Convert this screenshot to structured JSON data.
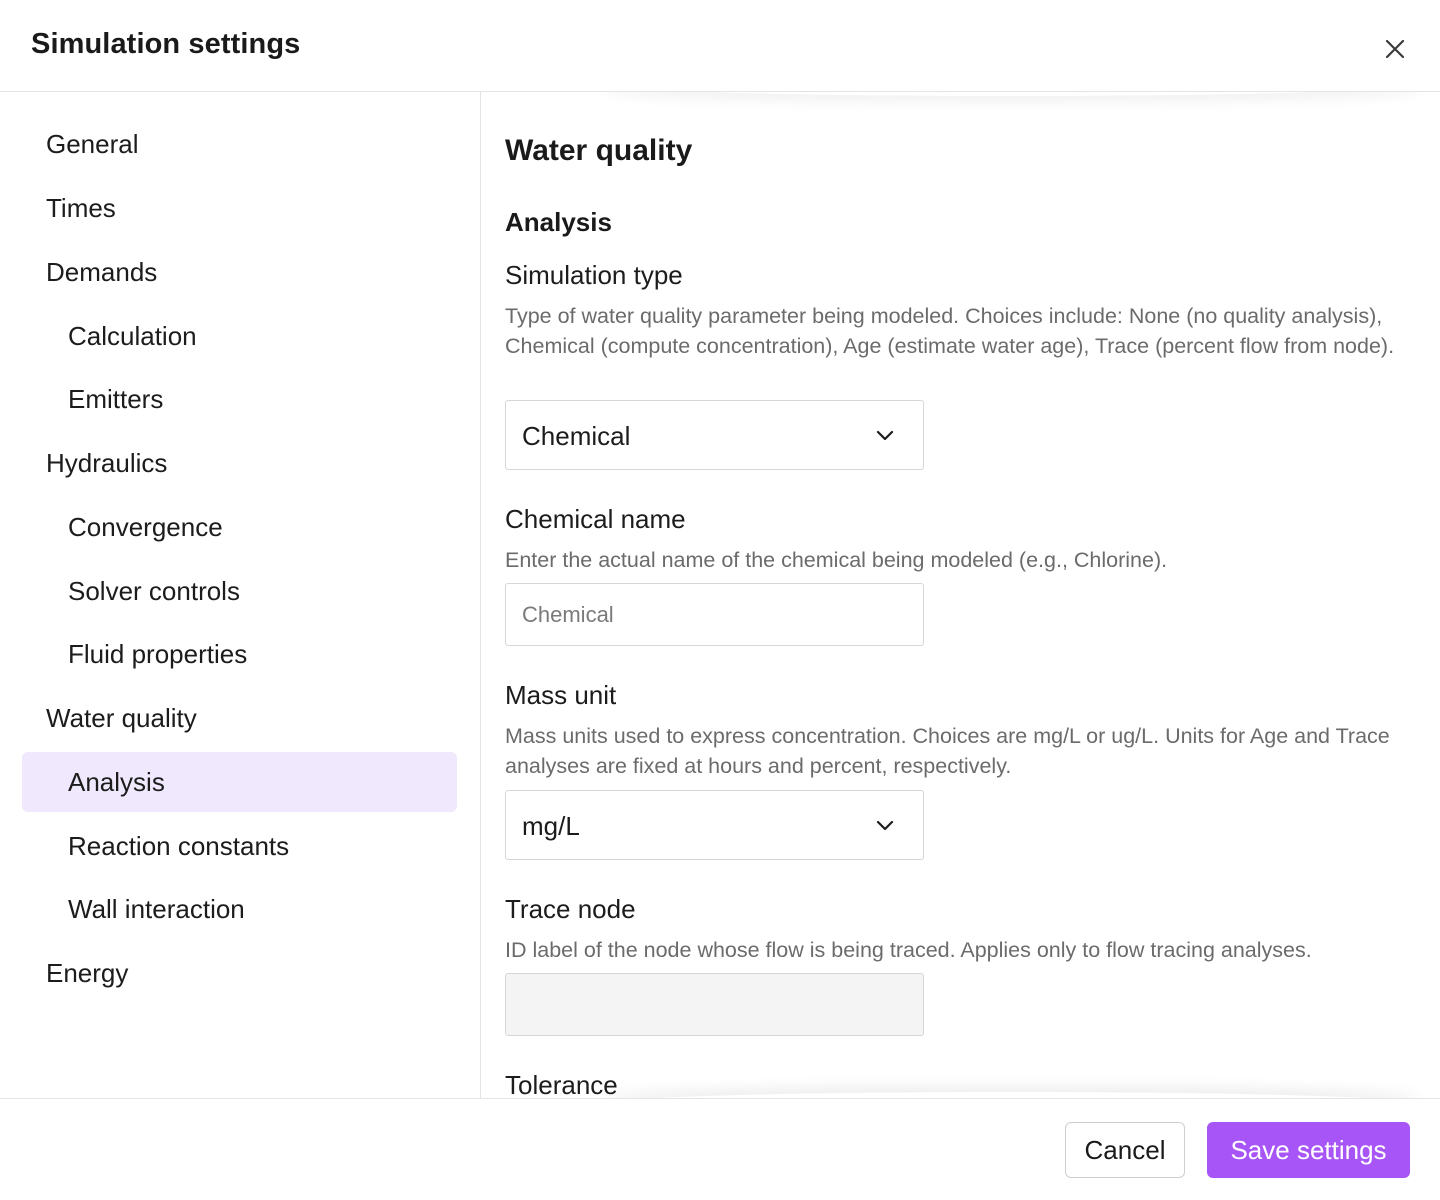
{
  "dialog": {
    "title": "Simulation settings",
    "close_icon": "close-icon"
  },
  "sidebar": {
    "items": [
      {
        "label": "General",
        "level": 0,
        "active": false
      },
      {
        "label": "Times",
        "level": 0,
        "active": false
      },
      {
        "label": "Demands",
        "level": 0,
        "active": false
      },
      {
        "label": "Calculation",
        "level": 1,
        "active": false
      },
      {
        "label": "Emitters",
        "level": 1,
        "active": false
      },
      {
        "label": "Hydraulics",
        "level": 0,
        "active": false
      },
      {
        "label": "Convergence",
        "level": 1,
        "active": false
      },
      {
        "label": "Solver controls",
        "level": 1,
        "active": false
      },
      {
        "label": "Fluid properties",
        "level": 1,
        "active": false
      },
      {
        "label": "Water quality",
        "level": 0,
        "active": false
      },
      {
        "label": "Analysis",
        "level": 1,
        "active": true
      },
      {
        "label": "Reaction constants",
        "level": 1,
        "active": false
      },
      {
        "label": "Wall interaction",
        "level": 1,
        "active": false
      },
      {
        "label": "Energy",
        "level": 0,
        "active": false
      }
    ]
  },
  "main": {
    "section_title": "Water quality",
    "subsection_title": "Analysis",
    "fields": {
      "simulation_type": {
        "label": "Simulation type",
        "help": "Type of water quality parameter being modeled. Choices include: None (no quality analysis), Chemical (compute concentration), Age (estimate water age), Trace (percent flow from node).",
        "value": "Chemical",
        "icon": "chevron-down-icon"
      },
      "chemical_name": {
        "label": "Chemical name",
        "help": "Enter the actual name of the chemical being modeled (e.g., Chlorine).",
        "value": "",
        "placeholder": "Chemical"
      },
      "mass_unit": {
        "label": "Mass unit",
        "help": "Mass units used to express concentration. Choices are mg/L or ug/L. Units for Age and Trace analyses are fixed at hours and percent, respectively.",
        "value": "mg/L",
        "icon": "chevron-down-icon"
      },
      "trace_node": {
        "label": "Trace node",
        "help": "ID label of the node whose flow is being traced. Applies only to flow tracing analyses.",
        "value": "",
        "placeholder": ""
      },
      "tolerance": {
        "label": "Tolerance"
      }
    }
  },
  "footer": {
    "cancel_label": "Cancel",
    "save_label": "Save settings"
  },
  "colors": {
    "accent": "#a855f7",
    "active_nav_bg": "#f0e8fd",
    "border": "#e4e4e4",
    "help_text": "#6b6b6b"
  }
}
